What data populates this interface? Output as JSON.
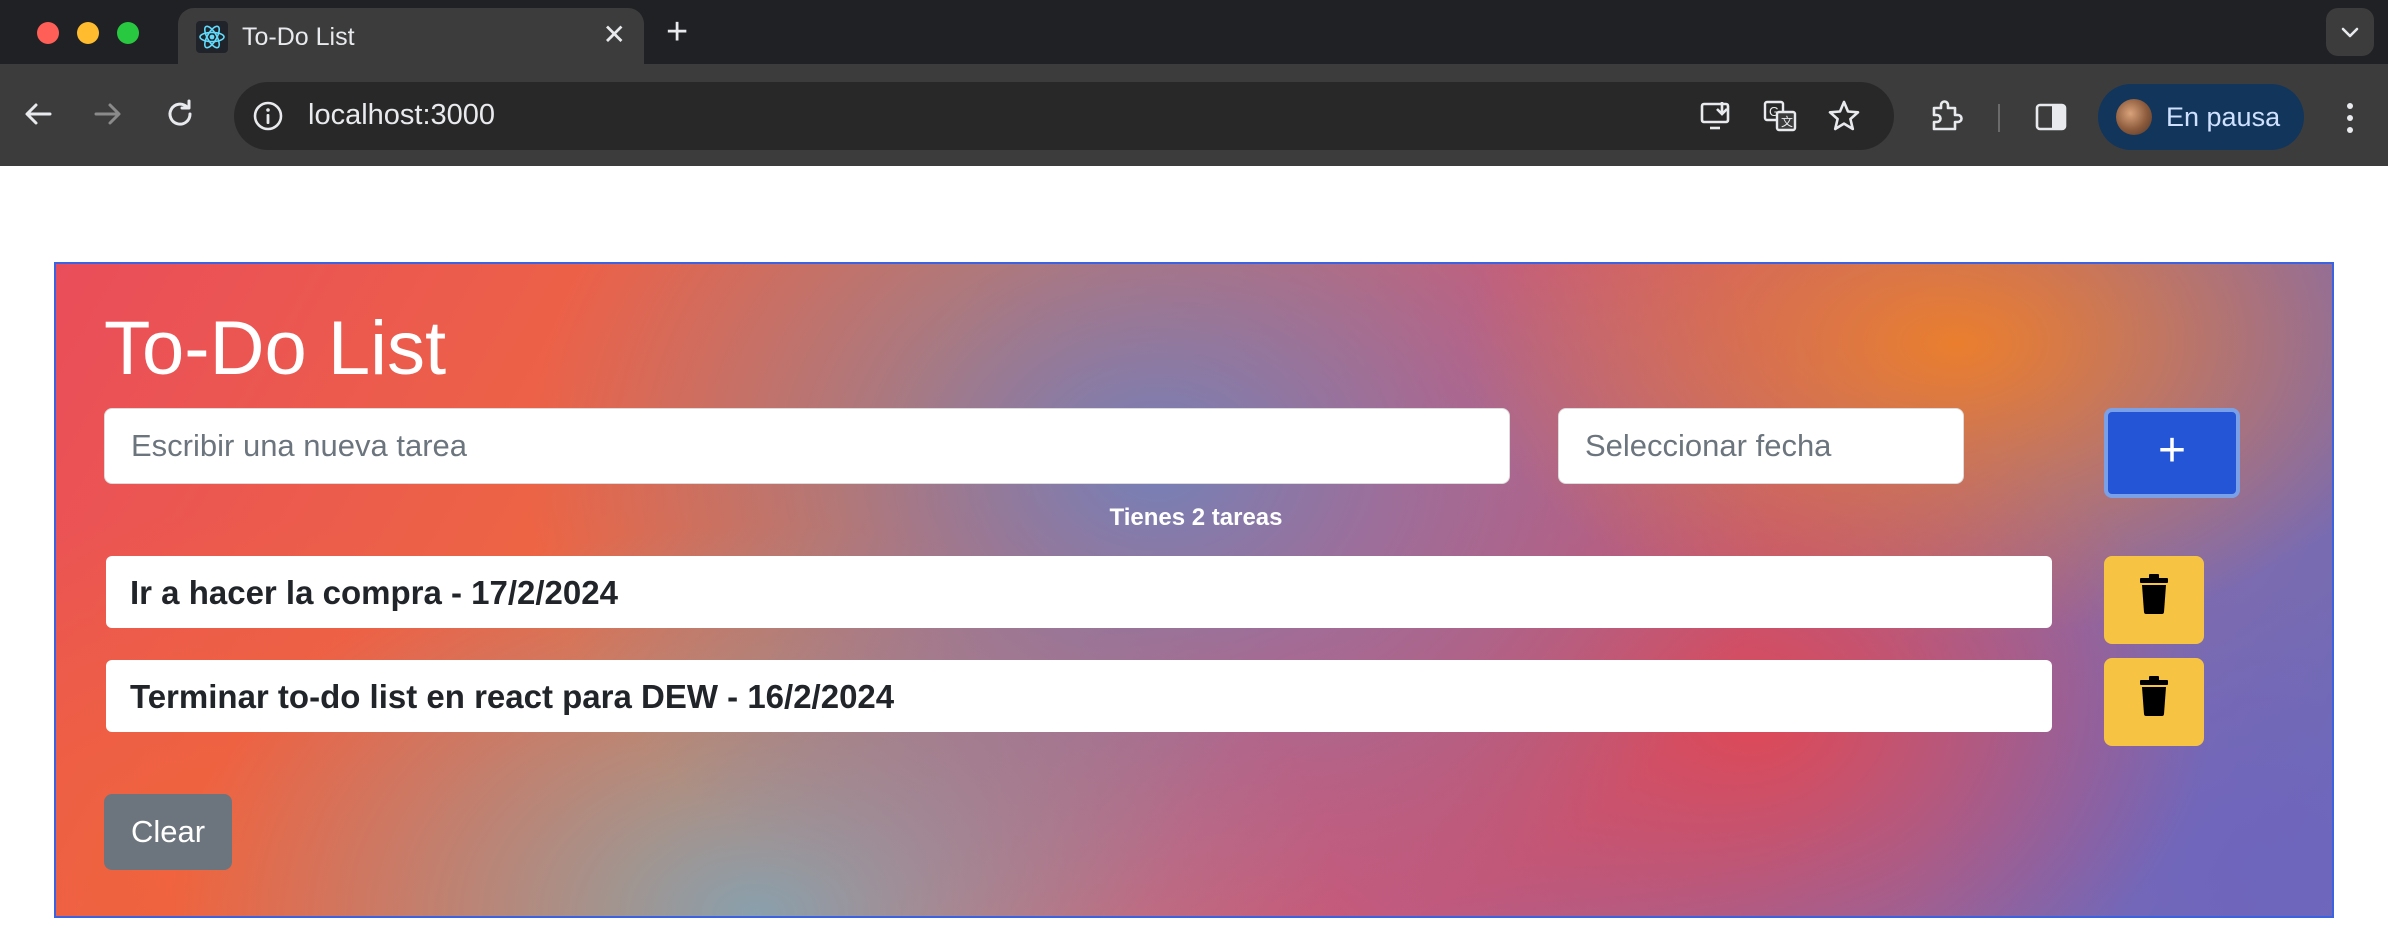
{
  "browser": {
    "tab": {
      "title": "To-Do List",
      "favicon": "react-icon",
      "close": "✕"
    },
    "new_tab": "+",
    "url": "localhost:3000",
    "profile": {
      "label": "En pausa"
    },
    "colors": {
      "tabbar": "#202124",
      "toolbar": "#3c3c3c",
      "profile_bg": "#12355b"
    }
  },
  "app": {
    "title": "To-Do List",
    "task_input": {
      "placeholder": "Escribir una nueva tarea",
      "value": ""
    },
    "date_input": {
      "placeholder": "Seleccionar fecha",
      "value": ""
    },
    "add_button": {
      "label": "+"
    },
    "task_count": "Tienes 2 tareas",
    "tasks": [
      {
        "text": "Ir a hacer la compra - 17/2/2024"
      },
      {
        "text": "Terminar to-do list en react para DEW - 16/2/2024"
      }
    ],
    "clear_button": {
      "label": "Clear"
    },
    "colors": {
      "add": "#2455d6",
      "delete": "#f6c343",
      "clear": "#6c757d"
    }
  }
}
